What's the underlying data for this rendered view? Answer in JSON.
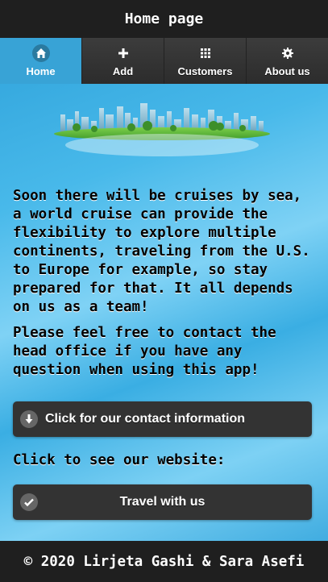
{
  "header": {
    "title": "Home page"
  },
  "navbar": {
    "items": [
      {
        "label": "Home",
        "icon": "home-icon",
        "active": true
      },
      {
        "label": "Add",
        "icon": "plus-icon",
        "active": false
      },
      {
        "label": "Customers",
        "icon": "grid-icon",
        "active": false
      },
      {
        "label": "About us",
        "icon": "gear-icon",
        "active": false
      }
    ]
  },
  "main": {
    "paragraph1": "Soon there will be cruises by sea, a world cruise can provide the flexibility to explore multiple continents, traveling from the U.S. to Europe for example, so stay prepared for that. It all depends on us as a team!",
    "paragraph2": "Please feel free to contact the head office if you have any question when using this app!",
    "contact_button": "Click for our contact information",
    "website_label": "Click to see our website:",
    "travel_button": "Travel with us"
  },
  "footer": {
    "text": "© 2020 Lirjeta Gashi & Sara Asefi"
  },
  "colors": {
    "accent": "#38a3d6",
    "bar": "#1f1f1f",
    "button": "#333333"
  }
}
